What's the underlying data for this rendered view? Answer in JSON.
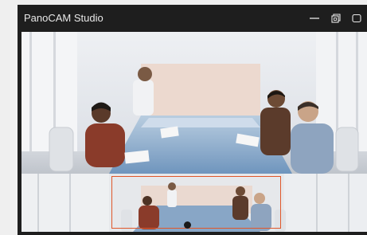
{
  "window": {
    "title": "PanoCAM Studio"
  },
  "controls": {
    "minimize_icon": "minimize-icon",
    "restore_icon": "restore-icon",
    "maximize_icon": "maximize-icon"
  },
  "colors": {
    "titlebar": "#1e1e1e",
    "title_text": "#e8e8e8",
    "viewport_border": "#e0572a",
    "page_background": "#efefef"
  },
  "scene": {
    "description_icon": "conference-room-panorama"
  }
}
